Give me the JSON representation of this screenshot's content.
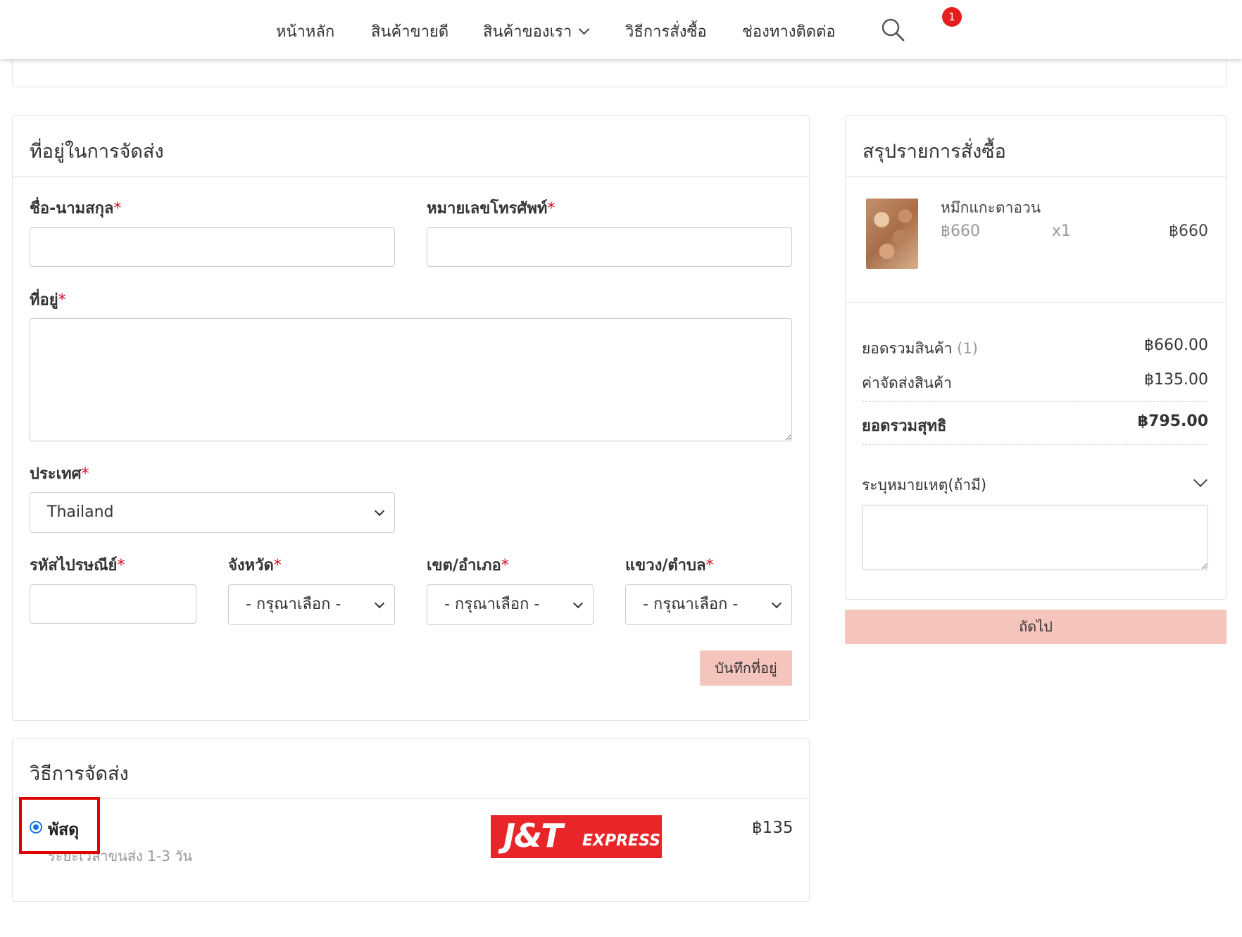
{
  "nav": {
    "items": [
      "หน้าหลัก",
      "สินค้าขายดี",
      "สินค้าของเรา",
      "วิธีการสั่งซื้อ",
      "ช่องทางติดต่อ"
    ],
    "cart_count": "1"
  },
  "address": {
    "title": "ที่อยู่ในการจัดส่ง",
    "name_label": "ชื่อ-นามสกุล",
    "phone_label": "หมายเลขโทรศัพท์",
    "address_label": "ที่อยู่",
    "country_label": "ประเทศ",
    "country_value": "Thailand",
    "postcode_label": "รหัสไปรษณีย์",
    "province_label": "จังหวัด",
    "district_label": "เขต/อำเภอ",
    "subdistrict_label": "แขวง/ตำบล",
    "select_placeholder": "- กรุณาเลือก -",
    "save_button": "บันทึกที่อยู่",
    "required_mark": "*"
  },
  "shipping": {
    "title": "วิธีการจัดส่ง",
    "option_label": "พัสดุ",
    "option_desc": "ระยะเวลาขนส่ง  1-3  วัน",
    "carrier_logo_text_a": "J&T",
    "carrier_logo_text_b": "EXPRESS",
    "price": "฿135"
  },
  "summary": {
    "title": "สรุปรายการสั่งซื้อ",
    "item_name": "หมึกแกะตาอวน",
    "item_unit_price": "฿660",
    "item_qty": "x1",
    "item_total": "฿660",
    "subtotal_label": "ยอดรวมสินค้า",
    "subtotal_count": "(1)",
    "subtotal_value": "฿660.00",
    "shipping_label": "ค่าจัดส่งสินค้า",
    "shipping_value": "฿135.00",
    "total_label": "ยอดรวมสุทธิ",
    "total_value": "฿795.00",
    "note_label": "ระบุหมายเหตุ(ถ้ามี)",
    "next_button": "ถัดไป"
  }
}
